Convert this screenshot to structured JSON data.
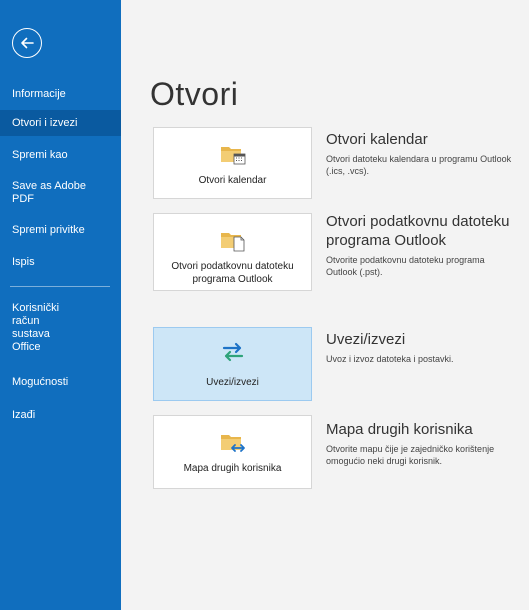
{
  "sidebar": {
    "items": [
      {
        "label": "Informacije"
      },
      {
        "label": "Otvori i izvezi"
      },
      {
        "label": "Spremi kao"
      },
      {
        "label": "Save as Adobe PDF"
      },
      {
        "label": "Spremi privitke"
      },
      {
        "label": "Ispis"
      },
      {
        "label": "Korisnički račun sustava Office"
      },
      {
        "label": "Mogućnosti"
      },
      {
        "label": "Izađi"
      }
    ]
  },
  "main": {
    "title": "Otvori",
    "options": [
      {
        "tile_label": "Otvori kalendar",
        "title": "Otvori kalendar",
        "description": "Otvori datoteku kalendara u programu Outlook (.ics, .vcs)."
      },
      {
        "tile_label": "Otvori podatkovnu datoteku programa Outlook",
        "title": "Otvori podatkovnu datoteku programa Outlook",
        "description": "Otvorite podatkovnu datoteku programa Outlook (.pst)."
      },
      {
        "tile_label": "Uvezi/izvezi",
        "title": "Uvezi/izvezi",
        "description": "Uvoz i izvoz datoteka i postavki."
      },
      {
        "tile_label": "Mapa drugih korisnika",
        "title": "Mapa drugih korisnika",
        "description": "Otvorite mapu čije je zajedničko korištenje omogućio neki drugi korisnik."
      }
    ]
  },
  "colors": {
    "sidebar_bg": "#106ebe",
    "sidebar_selected": "#0a5aa0",
    "tile_active_bg": "#cde6f7",
    "folder_yellow": "#e8b64c",
    "accent_green": "#2fa37a",
    "accent_blue": "#1e73c7"
  }
}
